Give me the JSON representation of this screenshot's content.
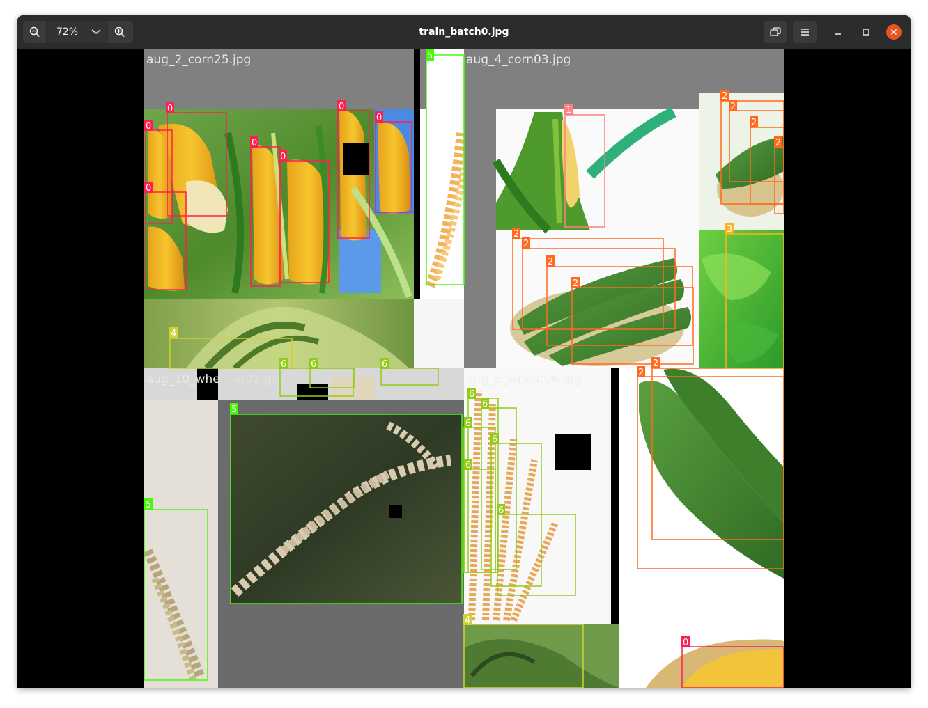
{
  "window": {
    "title": "train_batch0.jpg"
  },
  "toolbar": {
    "zoom_level": "72%",
    "zoom_out_icon": "zoom-out-icon",
    "zoom_in_icon": "zoom-in-icon",
    "zoom_dropdown_icon": "chevron-down-icon",
    "gallery_icon": "gallery-icon",
    "menu_icon": "hamburger-menu-icon",
    "minimize_icon": "minimize-icon",
    "maximize_icon": "maximize-icon",
    "close_icon": "close-icon"
  },
  "colors": {
    "titlebar": "#2c2c2c",
    "close": "#e95420",
    "class_0": "#ff1e50",
    "class_1": "#ff8080",
    "class_2": "#ff6a1e",
    "class_3": "#ffb21d",
    "class_4": "#cfd231",
    "class_5": "#48f90a",
    "class_6": "#92cc17"
  },
  "image": {
    "filenames": {
      "tile_tl": "aug_2_corn25.jpg",
      "tile_tr": "aug_4_corn03.jpg",
      "tile_bl": "aug_10_whe",
      "tile_bl_rest": "at01.jpg",
      "tile_br": "aug_8_wheat06.jpg"
    },
    "labels": {
      "l0a": "0",
      "l0b": "0",
      "l0c": "0",
      "l0d": "0",
      "l0e": "0",
      "l0f": "0",
      "l0g": "0",
      "l0h": "0",
      "l5a": "5",
      "l5b": "5",
      "l5c": "5",
      "l1a": "1",
      "l2a": "2",
      "l2b": "2",
      "l2c": "2",
      "l2d": "2",
      "l2e": "2",
      "l2f": "2",
      "l2g": "2",
      "l2h": "2",
      "l2i": "2",
      "l2j": "2",
      "l3a": "3",
      "l4a": "4",
      "l4b": "4",
      "l6a": "6",
      "l6b": "6",
      "l6c": "6",
      "l6d": "6",
      "l6e": "6",
      "l6f": "6",
      "l6g": "6",
      "l6h": "6",
      "l6i": "6"
    }
  }
}
